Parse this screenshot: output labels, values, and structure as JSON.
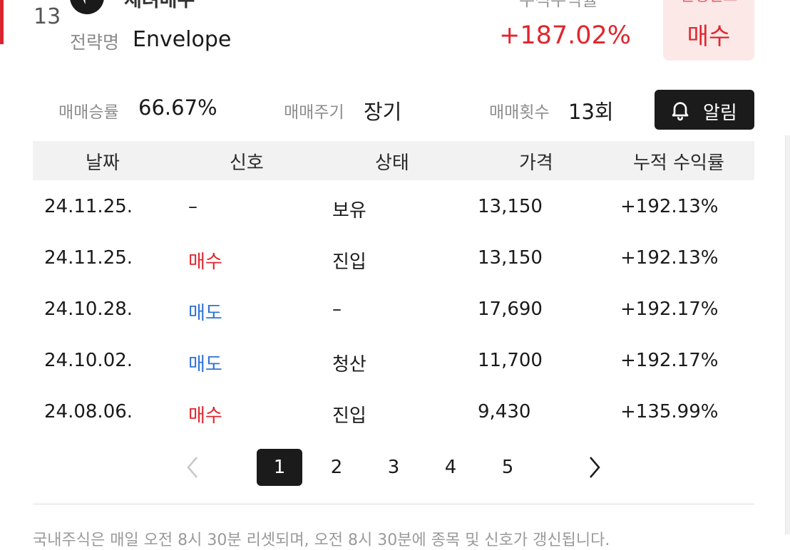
{
  "header": {
    "rank": "13",
    "strategy_top_text": "세려매수",
    "strategy_label": "전략명",
    "strategy_name": "Envelope",
    "return_top_text": "누적수익률",
    "return_value": "+187.02%",
    "signal_top_text": "실행신호",
    "signal_value": "매수"
  },
  "stats": {
    "win_rate_label": "매매승률",
    "win_rate_value": "66.67%",
    "period_label": "매매주기",
    "period_value": "장기",
    "count_label": "매매횟수",
    "count_value": "13회",
    "alert_label": "알림"
  },
  "table": {
    "headers": [
      "날짜",
      "신호",
      "상태",
      "가격",
      "누적 수익률"
    ],
    "rows": [
      {
        "date": "24.11.25.",
        "signal": "–",
        "status": "보유",
        "price": "13,150",
        "return": "+192.13%"
      },
      {
        "date": "24.11.25.",
        "signal": "매수",
        "status": "진입",
        "price": "13,150",
        "return": "+192.13%"
      },
      {
        "date": "24.10.28.",
        "signal": "매도",
        "status": "–",
        "price": "17,690",
        "return": "+192.17%"
      },
      {
        "date": "24.10.02.",
        "signal": "매도",
        "status": "청산",
        "price": "11,700",
        "return": "+192.17%"
      },
      {
        "date": "24.08.06.",
        "signal": "매수",
        "status": "진입",
        "price": "9,430",
        "return": "+135.99%"
      }
    ]
  },
  "pagination": {
    "pages": [
      "1",
      "2",
      "3",
      "4",
      "5"
    ],
    "current": "1"
  },
  "notice": "국내주식은 매일 오전 8시 30분 리셋되며, 오전 8시 30분에 종목 및 신호가 갱신됩니다.",
  "colors": {
    "buy": "#e0262e",
    "sell": "#2f73d4",
    "accent_dark": "#1b1b1b",
    "signal_bg": "#fde8e8"
  }
}
